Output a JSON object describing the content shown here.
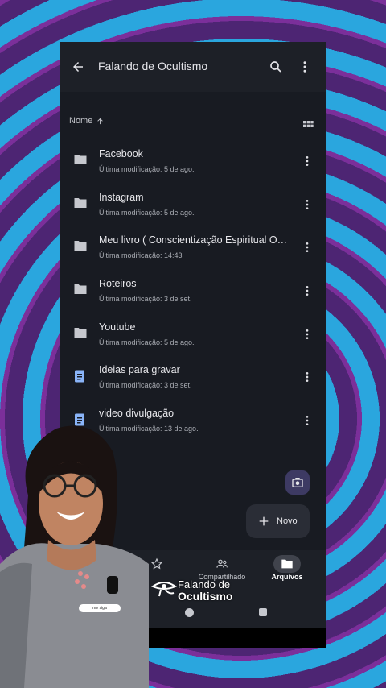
{
  "appbar": {
    "title": "Falando de Ocultismo"
  },
  "sort": {
    "label": "Nome",
    "direction_icon": "arrow-up-icon"
  },
  "files": [
    {
      "name": "Facebook",
      "meta": "Última modificação: 5 de ago.",
      "kind": "folder"
    },
    {
      "name": "Instagram",
      "meta": "Última modificação: 5 de ago.",
      "kind": "folder"
    },
    {
      "name": "Meu livro ( Conscientização Espiritual Ocu...",
      "meta": "Última modificação: 14:43",
      "kind": "folder"
    },
    {
      "name": "Roteiros",
      "meta": "Última modificação: 3 de set.",
      "kind": "folder"
    },
    {
      "name": "Youtube",
      "meta": "Última modificação: 5 de ago.",
      "kind": "folder"
    },
    {
      "name": "Ideias para gravar",
      "meta": "Última modificação: 3 de set.",
      "kind": "doc"
    },
    {
      "name": "video divulgação",
      "meta": "Última modificação: 13 de ago.",
      "kind": "doc"
    }
  ],
  "fab": {
    "new_label": "Novo"
  },
  "nav": {
    "shared_label": "Compartilhado",
    "files_label": "Arquivos"
  },
  "overlay": {
    "watermark_line1": "Falando de",
    "watermark_line2": "Ocultismo",
    "badge": "me siga"
  },
  "colors": {
    "folder": "#c6c8ce",
    "doc": "#8ab4f8",
    "background": "#181b22"
  }
}
